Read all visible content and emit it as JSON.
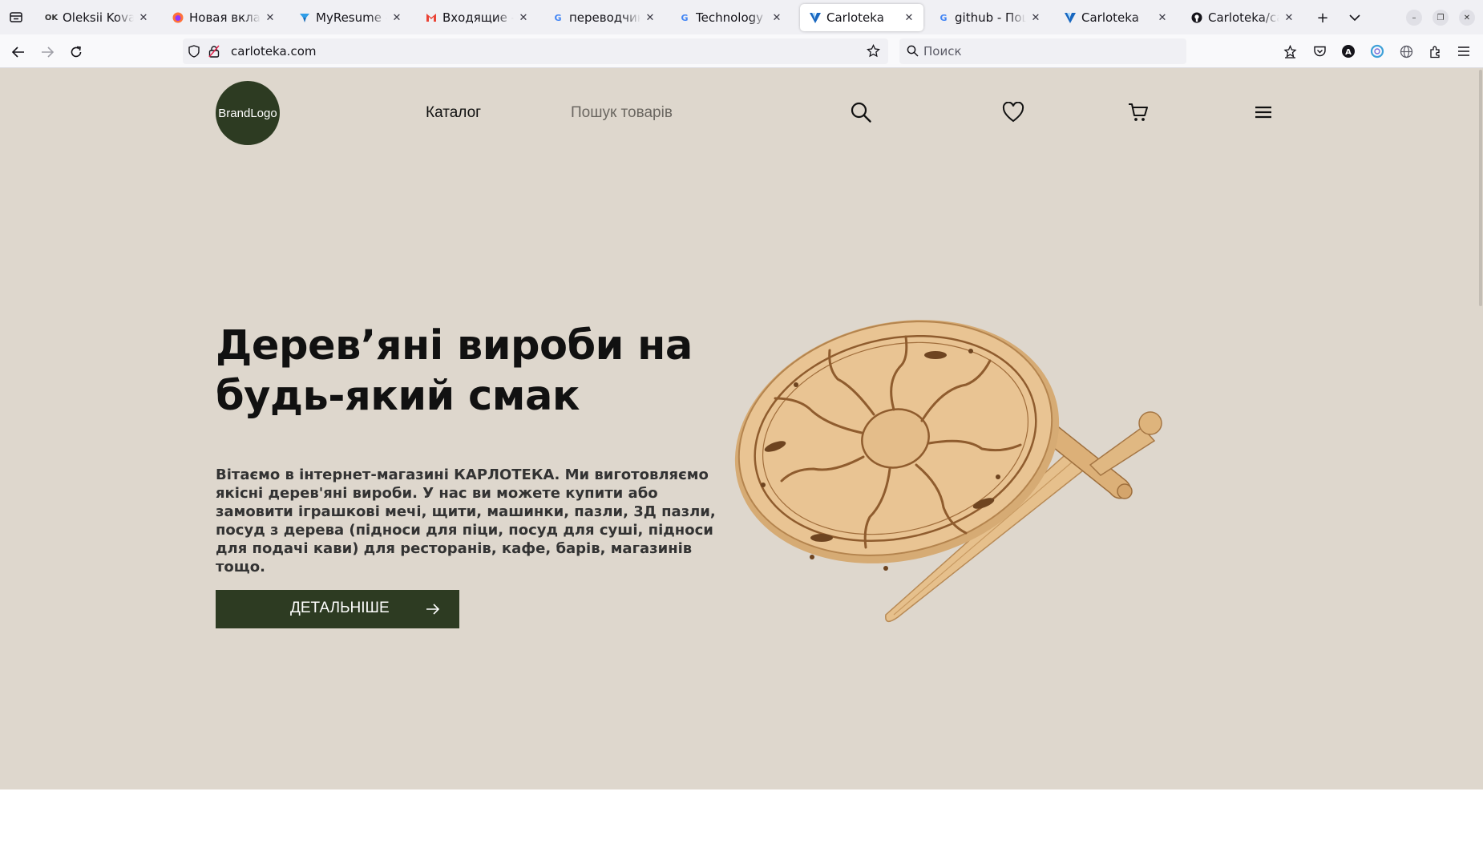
{
  "browser": {
    "tabs": [
      {
        "title": "Oleksii Kovalen",
        "favicon": "ok-icon"
      },
      {
        "title": "Новая вкладка",
        "favicon": "firefox-icon"
      },
      {
        "title": "MyResume - Bo",
        "favicon": "myresume-icon"
      },
      {
        "title": "Входящие - ale",
        "favicon": "gmail-icon"
      },
      {
        "title": "переводчик гу",
        "favicon": "google-icon"
      },
      {
        "title": "Technology sta",
        "favicon": "google-icon"
      },
      {
        "title": "Carloteka",
        "favicon": "vuetify-icon",
        "active": true
      },
      {
        "title": "github - Пошук",
        "favicon": "google-icon"
      },
      {
        "title": "Carloteka",
        "favicon": "vuetify-icon"
      },
      {
        "title": "Carloteka/carlo",
        "favicon": "github-icon"
      }
    ],
    "url": "carloteka.com",
    "search_placeholder": "Поиск"
  },
  "site": {
    "logo_text": "BrandLogo",
    "nav": {
      "catalog": "Каталог",
      "product_search": "Пошук товарів"
    },
    "hero": {
      "title": "Дерев’яні вироби на будь-який смак",
      "text": "Вітаємо в інтернет-магазині КАРЛОТЕКА. Ми виготовляємо якісні дерев'яні вироби. У нас ви можете купити або замовити іграшкові мечі, щити, машинки, пазли, 3Д пазли, посуд з дерева (підноси для піци, посуд для суші, підноси для подачі кави) для ресторанів, кафе, барів, магазинів тощо.",
      "button": "ДЕТАЛЬНІШЕ"
    }
  },
  "colors": {
    "page_bg": "#ded7cd",
    "brand_green": "#2d3b22",
    "wood": "#e0b98a"
  }
}
